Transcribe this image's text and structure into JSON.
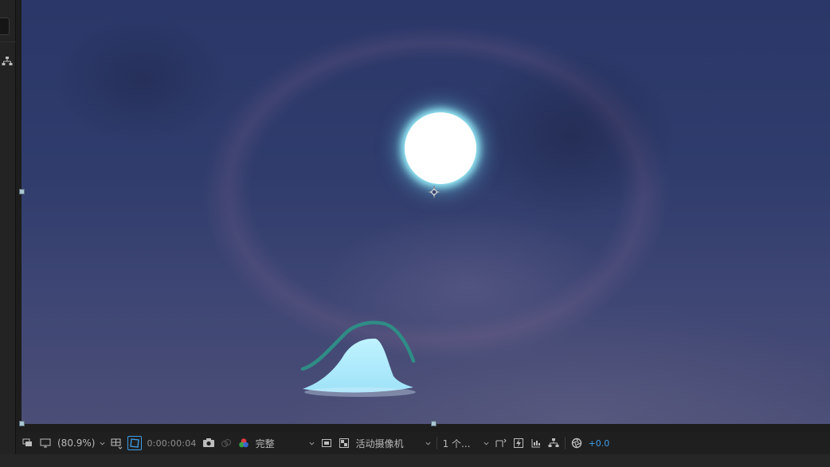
{
  "viewer": {
    "zoom": "(80.9%)",
    "timecode": "0:00:00:04",
    "resolution": "完整",
    "camera": "活动摄像机",
    "views": "1 个...",
    "exposure": "+0.0"
  },
  "colors": {
    "panel_bg": "#1d1d1d",
    "toolbar_bg": "#1f1f1f",
    "sky_top": "#2a3768",
    "sky_bottom": "#4b4e76",
    "moon": "#ffffff",
    "moon_glow": "#9ff6ff",
    "accent_blue": "#3f9ee8",
    "mountain": "#b4f0ff",
    "mountain_stroke": "#2f8c86"
  },
  "icons": {
    "always_preview": "always-preview-icon",
    "monitor": "monitor-icon",
    "safe_zones": "safe-zones-icon",
    "mask_path": "mask-visibility-icon",
    "snapshot": "camera-snapshot-icon",
    "show_snapshot": "show-snapshot-icon",
    "channels": "rgb-channels-icon",
    "region": "region-of-interest-icon",
    "transparency": "transparency-grid-icon",
    "draft3d": "draft-3d-icon",
    "fast_preview": "fast-preview-icon",
    "timeline": "timeline-icon",
    "flowchart": "flowchart-icon",
    "reset_exposure": "reset-exposure-icon"
  }
}
